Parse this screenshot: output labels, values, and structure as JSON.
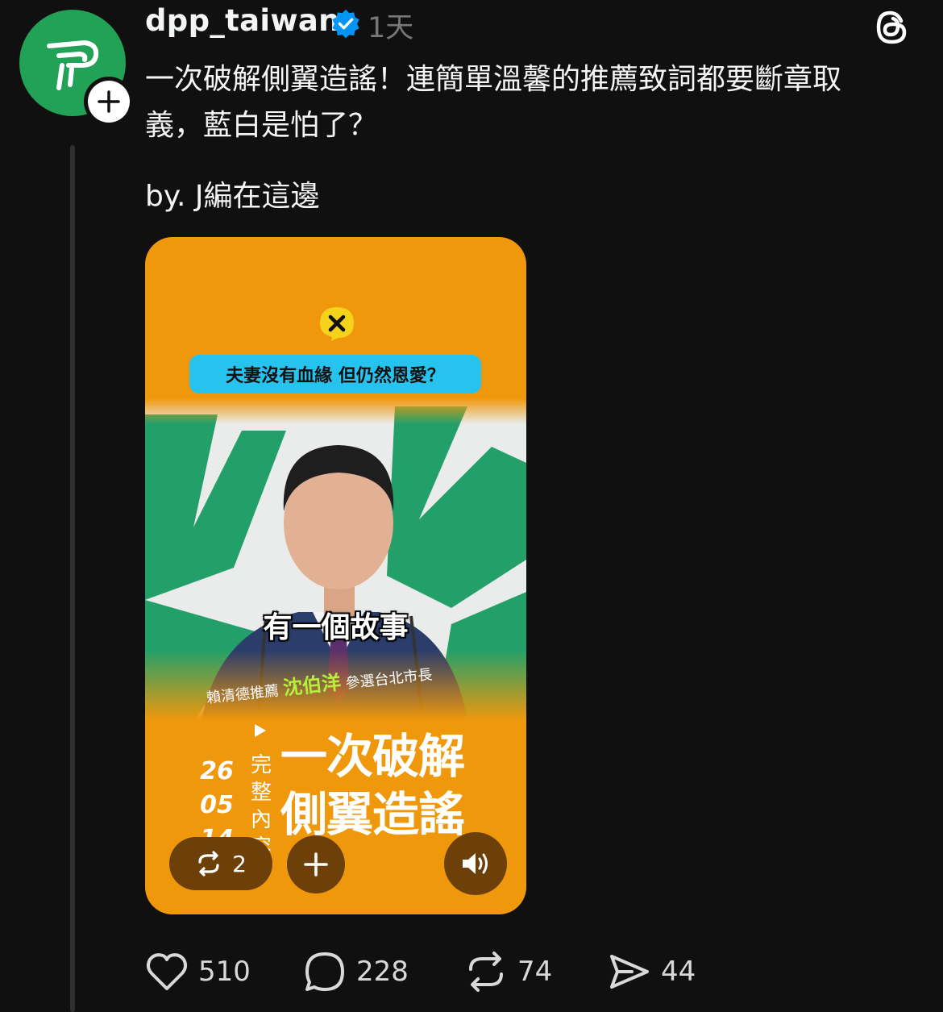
{
  "post": {
    "username": "dpp_taiwan",
    "time": "1天",
    "text_line1": "一次破解側翼造謠！連簡單溫馨的推薦致詞都要斷章取",
    "text_line2": "義，藍白是怕了？",
    "signature": "by. J編在這邊"
  },
  "media": {
    "question": "夫妻沒有血緣 但仍然恩愛？",
    "caption": "有一個故事",
    "subline_pre": "賴清德推薦",
    "subline_name": "沈伯洋",
    "subline_post": "參選台北市長",
    "date_parts": [
      "26",
      "05",
      "14"
    ],
    "full_content_label": [
      "完",
      "整",
      "內",
      "容"
    ],
    "headline_line1": "一次破解",
    "headline_line2": "側翼造謠",
    "repost_count": "2"
  },
  "actions": {
    "likes": "510",
    "replies": "228",
    "reposts": "74",
    "shares": "44"
  },
  "colors": {
    "background": "#101010",
    "avatar": "#22a257",
    "media": "#f0980c",
    "question_bar": "#27c3ef",
    "verified": "#0095f6",
    "highlight_name": "#b4f03c"
  },
  "icons": [
    "dpp-logo-icon",
    "plus-icon",
    "verified-badge-icon",
    "threads-logo-icon",
    "close-icon",
    "repost-icon",
    "add-icon",
    "speaker-icon",
    "heart-icon",
    "comment-icon",
    "share-icon"
  ]
}
